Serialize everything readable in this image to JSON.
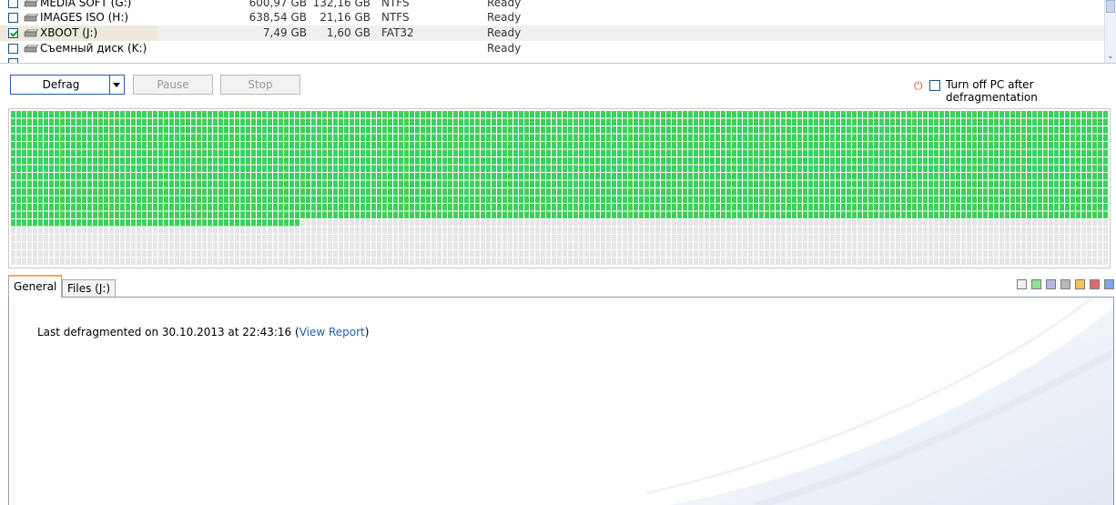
{
  "drives": [
    {
      "name": "MEDIA SOFT (G:)",
      "size": "600,97 GB",
      "free": "132,16 GB",
      "fs": "NTFS",
      "status": "Ready",
      "checked": false,
      "selected": false
    },
    {
      "name": "IMAGES ISO (H:)",
      "size": "638,54 GB",
      "free": "21,16 GB",
      "fs": "NTFS",
      "status": "Ready",
      "checked": false,
      "selected": false
    },
    {
      "name": "XBOOT (J:)",
      "size": "7,49 GB",
      "free": "1,60 GB",
      "fs": "FAT32",
      "status": "Ready",
      "checked": true,
      "selected": true
    },
    {
      "name": "Съемный диск (K:)",
      "size": "",
      "free": "",
      "fs": "",
      "status": "Ready",
      "checked": false,
      "selected": false
    }
  ],
  "toolbar": {
    "defrag_label": "Defrag",
    "pause_label": "Pause",
    "stop_label": "Stop",
    "shutdown_label": "Turn off PC after defragmentation",
    "shutdown_checked": false
  },
  "cluster_map": {
    "columns": 202,
    "rows": 20,
    "used_fraction": 0.713,
    "used_color": "#3fcf5e",
    "free_color": "#e6e6e6"
  },
  "tabs": [
    {
      "label": "General",
      "active": true
    },
    {
      "label": "Files (J:)",
      "active": false
    }
  ],
  "legend_colors": [
    "#f0f0f0",
    "#8fe08f",
    "#b9b3e6",
    "#b8b8b8",
    "#f5c15a",
    "#e06a6a",
    "#7ea6ea"
  ],
  "general": {
    "last_prefix": "Last defragmented on 30.10.2013 at 22:43:16 (",
    "view_report": "View Report",
    "last_suffix": ")"
  }
}
